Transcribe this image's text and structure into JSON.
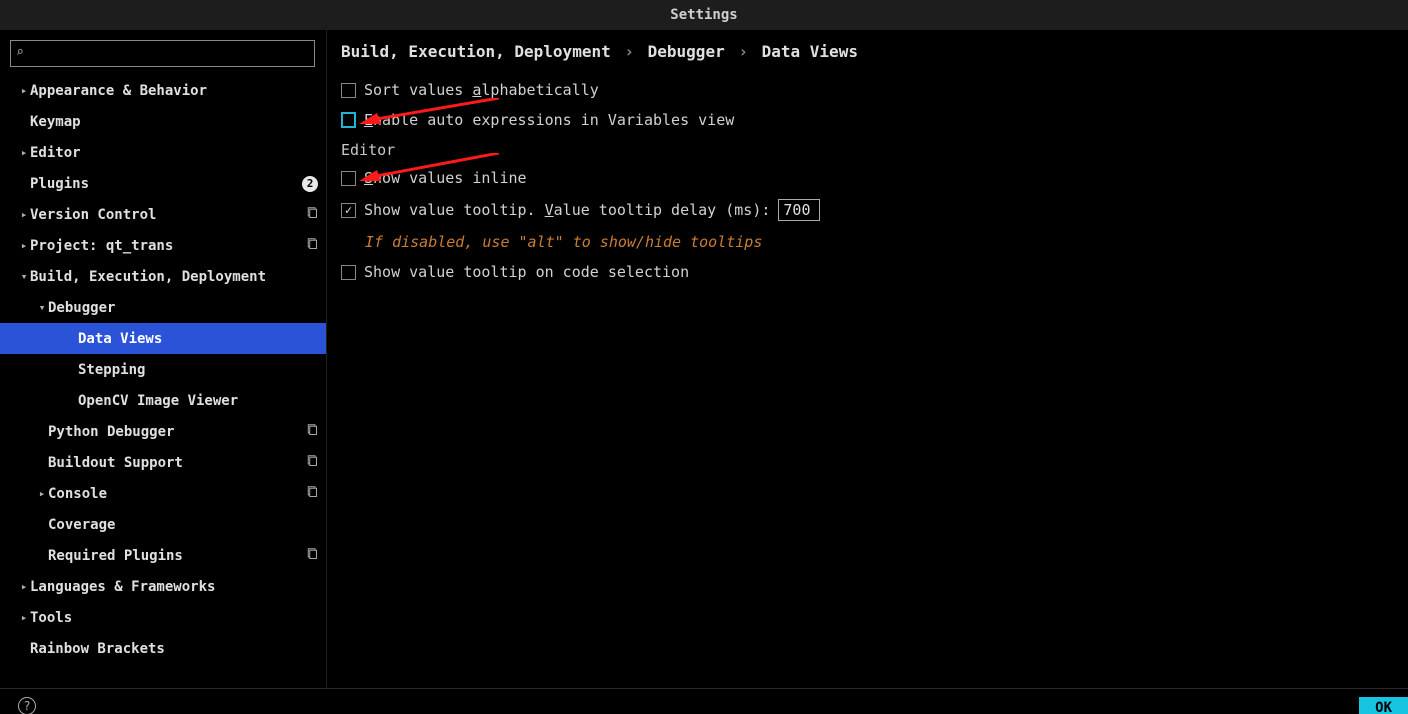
{
  "window": {
    "title": "Settings"
  },
  "search": {
    "placeholder": ""
  },
  "sidebar": [
    {
      "label": "Appearance & Behavior",
      "level": 0,
      "arrow": "right",
      "badge": ""
    },
    {
      "label": "Keymap",
      "level": 0,
      "arrow": "",
      "badge": ""
    },
    {
      "label": "Editor",
      "level": 0,
      "arrow": "right",
      "badge": ""
    },
    {
      "label": "Plugins",
      "level": 0,
      "arrow": "",
      "badge": "count",
      "badge_val": "2"
    },
    {
      "label": "Version Control",
      "level": 0,
      "arrow": "right",
      "badge": "copy"
    },
    {
      "label": "Project: qt_trans",
      "level": 0,
      "arrow": "right",
      "badge": "copy"
    },
    {
      "label": "Build, Execution, Deployment",
      "level": 0,
      "arrow": "down",
      "badge": ""
    },
    {
      "label": "Debugger",
      "level": 1,
      "arrow": "down",
      "badge": ""
    },
    {
      "label": "Data Views",
      "level": "2p",
      "arrow": "",
      "badge": "",
      "selected": true
    },
    {
      "label": "Stepping",
      "level": "2p",
      "arrow": "",
      "badge": ""
    },
    {
      "label": "OpenCV Image Viewer",
      "level": "2p",
      "arrow": "",
      "badge": ""
    },
    {
      "label": "Python Debugger",
      "level": 1,
      "arrow": "",
      "badge": "copy"
    },
    {
      "label": "Buildout Support",
      "level": 1,
      "arrow": "",
      "badge": "copy"
    },
    {
      "label": "Console",
      "level": 1,
      "arrow": "right",
      "badge": "copy"
    },
    {
      "label": "Coverage",
      "level": 1,
      "arrow": "",
      "badge": ""
    },
    {
      "label": "Required Plugins",
      "level": 1,
      "arrow": "",
      "badge": "copy"
    },
    {
      "label": "Languages & Frameworks",
      "level": 0,
      "arrow": "right",
      "badge": ""
    },
    {
      "label": "Tools",
      "level": 0,
      "arrow": "right",
      "badge": ""
    },
    {
      "label": "Rainbow Brackets",
      "level": 0,
      "arrow": "",
      "badge": ""
    }
  ],
  "breadcrumb": {
    "a": "Build, Execution, Deployment",
    "b": "Debugger",
    "c": "Data Views"
  },
  "opts": {
    "sort_alpha": {
      "label_pre": "Sort values ",
      "label_u": "a",
      "label_post": "lphabetically",
      "checked": false
    },
    "auto_expr": {
      "label_pre": "",
      "label_u": "E",
      "label_post": "nable auto expressions in Variables view",
      "checked": false,
      "highlight": true
    },
    "editor_header": "Editor",
    "inline": {
      "label_pre": "",
      "label_u": "S",
      "label_post": "how values inline",
      "checked": false
    },
    "tooltip": {
      "label_pre": "Show value tooltip. ",
      "label_u": "V",
      "label_post": "alue tooltip delay (ms): ",
      "checked": true,
      "value": "700"
    },
    "tooltip_hint": "If disabled, use \"alt\" to show/hide tooltips",
    "tooltip_sel": {
      "label": "Show value tooltip on code selection",
      "checked": false
    }
  },
  "footer": {
    "ok": "OK"
  },
  "arrows": {
    "glyph_right": "▸",
    "glyph_down": "▾"
  }
}
